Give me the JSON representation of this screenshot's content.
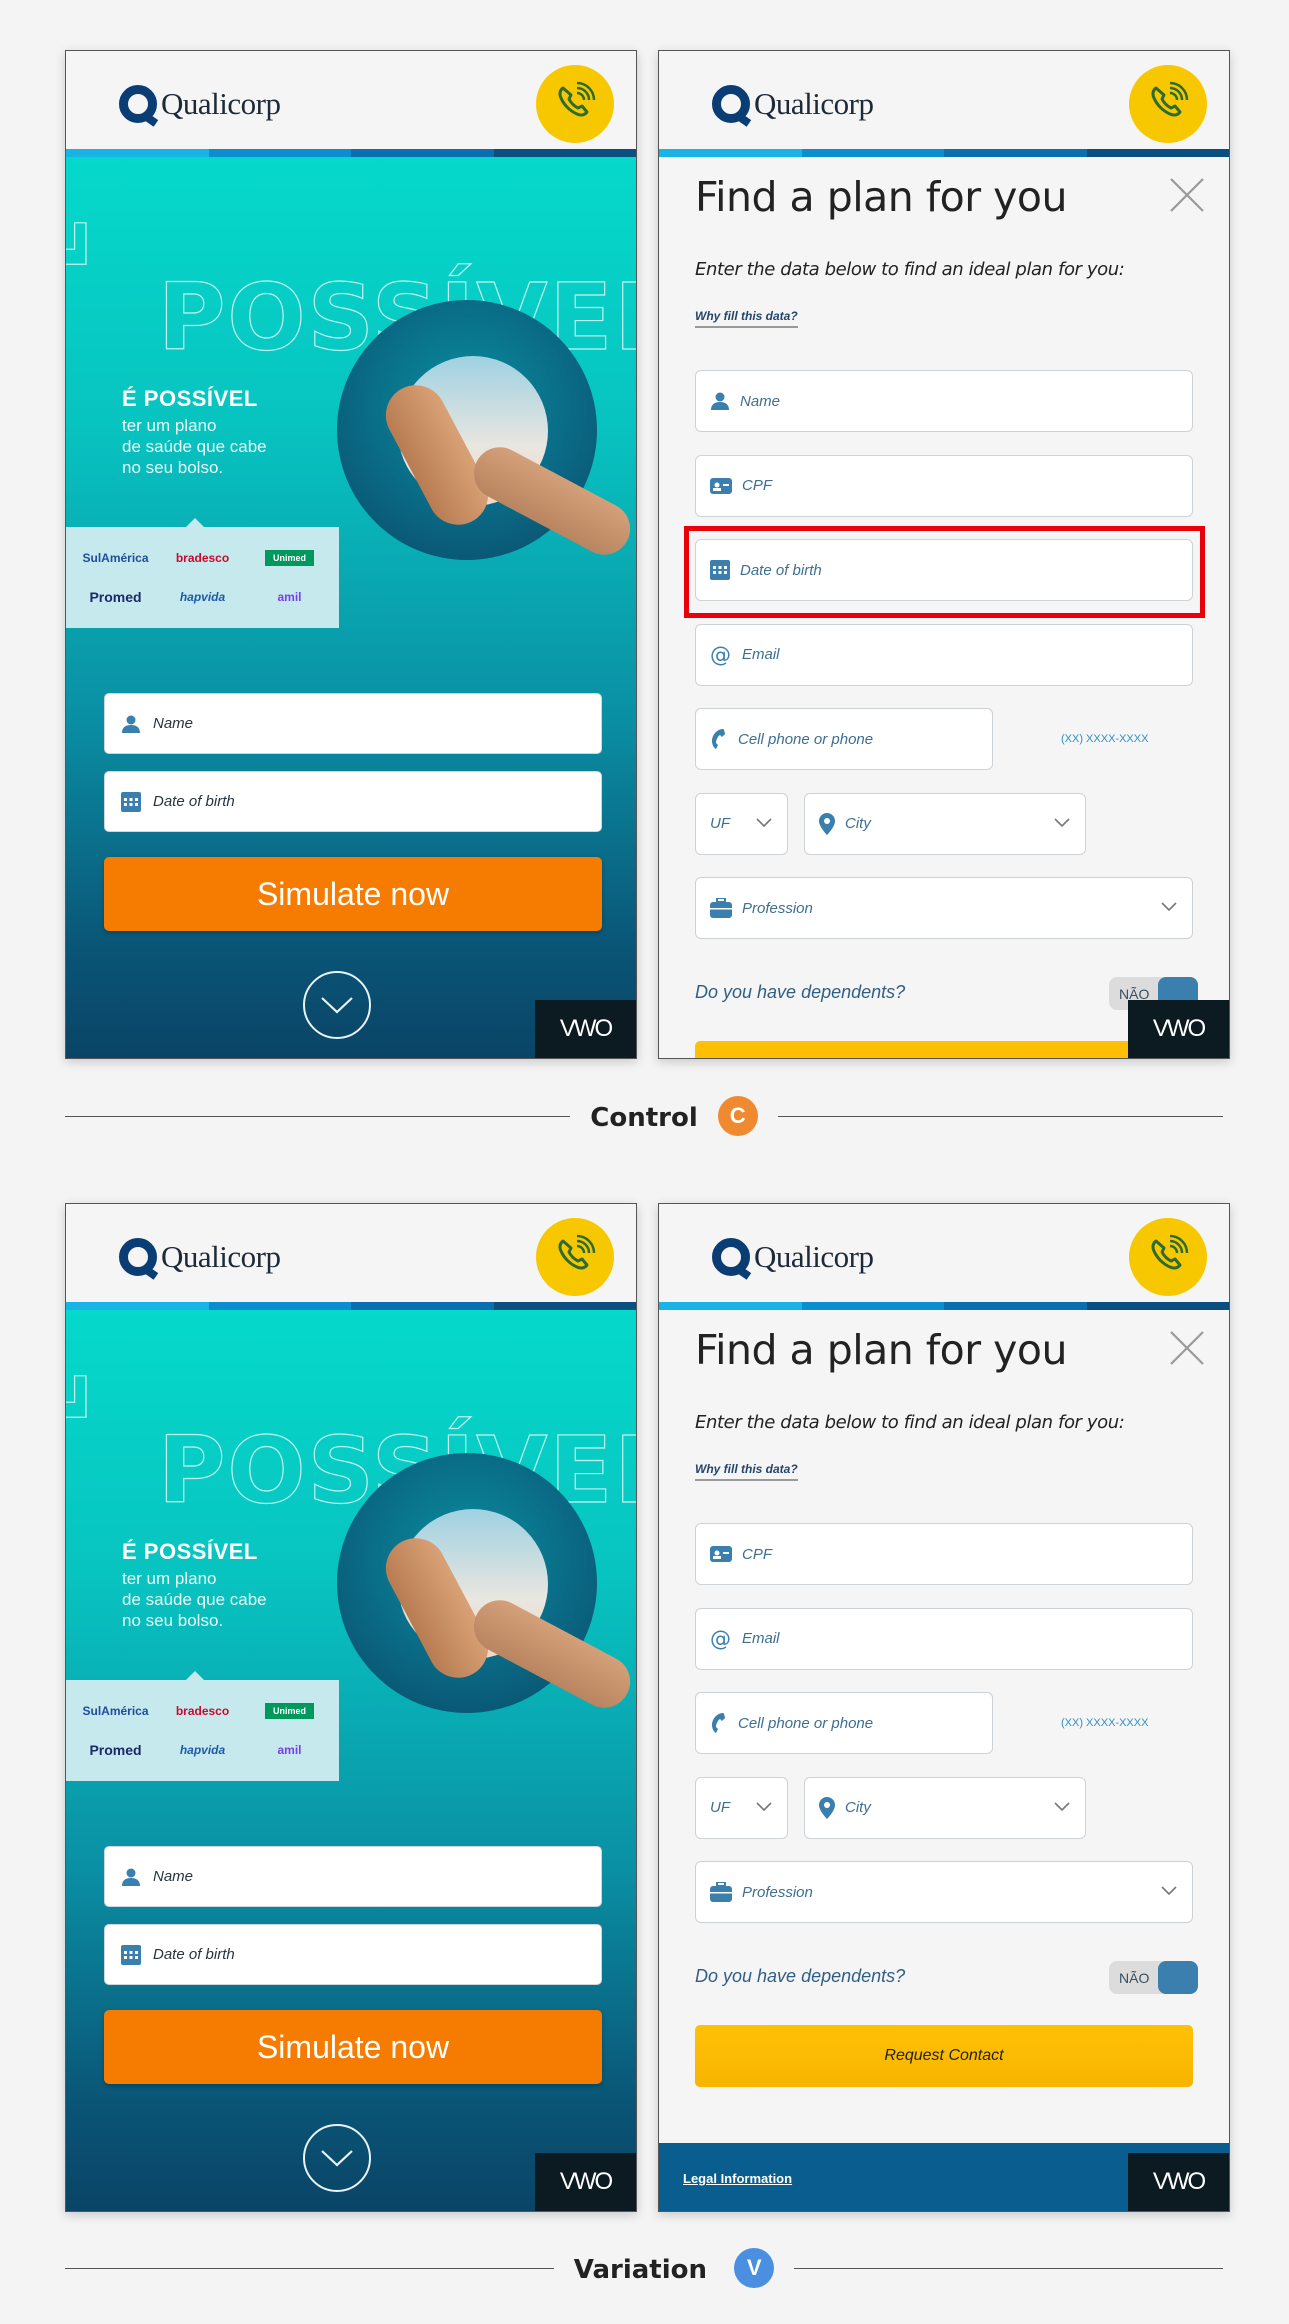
{
  "brand": "Qualicorp",
  "colors": {
    "stripe": [
      "#19b3e6",
      "#0a8ed0",
      "#0a6fb0",
      "#0b4e80"
    ],
    "call_button": "#f7c800",
    "simulate": "#f57c00",
    "request": "#ffc107",
    "highlight": "#e8000b"
  },
  "landing": {
    "outline_word": "POSSÍVEL",
    "outline_side": "É",
    "headline": "É POSSÍVEL",
    "subtext": [
      "ter um plano",
      "de saúde que cabe",
      "no seu bolso."
    ],
    "insurers": [
      "SulAmérica",
      "bradesco",
      "Unimed",
      "Promed",
      "hapvida",
      "amil"
    ],
    "name_placeholder": "Name",
    "dob_placeholder": "Date of birth",
    "simulate_label": "Simulate now",
    "vwo": "VWO"
  },
  "form": {
    "title": "Find a plan for you",
    "subtitle": "Enter the data below to find an ideal plan for you:",
    "why_link": "Why fill this data?",
    "placeholders": {
      "name": "Name",
      "cpf": "CPF",
      "dob": "Date of birth",
      "email": "Email",
      "phone": "Cell phone or phone",
      "uf": "UF",
      "city": "City",
      "profession": "Profession"
    },
    "phone_hint": "(XX) XXXX-XXXX",
    "dependents_question": "Do you have dependents?",
    "toggle_label": "NÃO",
    "request_label": "Request Contact",
    "legal_link": "Legal Information"
  },
  "variants": [
    {
      "label": "Control",
      "badge": "C",
      "badge_color": "#f08a30",
      "fields": [
        "name",
        "cpf",
        "dob",
        "email",
        "phone",
        "ufcity",
        "profession"
      ],
      "highlighted_field": "dob"
    },
    {
      "label": "Variation",
      "badge": "V",
      "badge_color": "#4a8fe0",
      "fields": [
        "cpf",
        "email",
        "phone",
        "ufcity",
        "profession"
      ]
    }
  ]
}
